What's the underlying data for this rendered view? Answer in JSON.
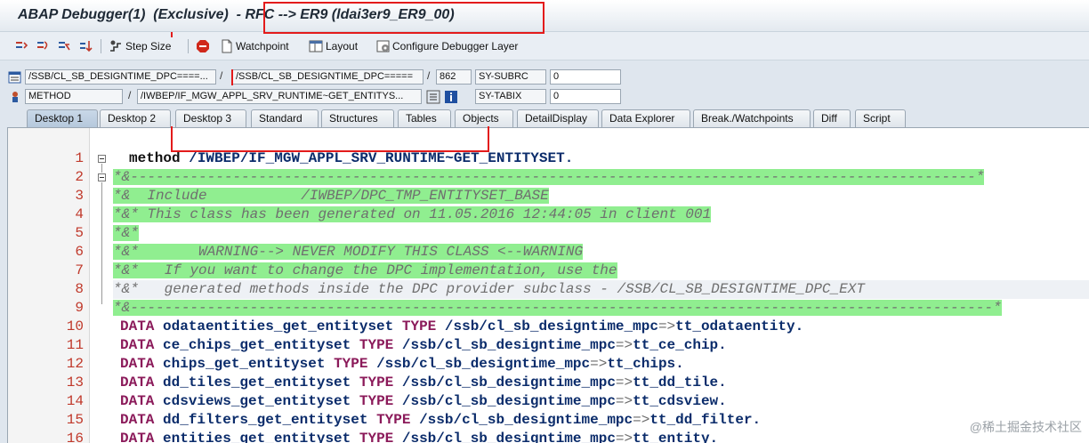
{
  "window": {
    "title": "ABAP Debugger(1)  (Exclusive)  - RFC --> ER9 (ldai3er9_ER9_00)"
  },
  "toolbar": {
    "step_size": "Step Size",
    "watchpoint": "Watchpoint",
    "layout": "Layout",
    "configure": "Configure Debugger Layer"
  },
  "info": {
    "program1": "/SSB/CL_SB_DESIGNTIME_DPC====...",
    "program2": "/SSB/CL_SB_DESIGNTIME_DPC=====",
    "line_no": "862",
    "sysvar1_name": "SY-SUBRC",
    "sysvar1_value": "0",
    "type": "METHOD",
    "method": "/IWBEP/IF_MGW_APPL_SRV_RUNTIME~GET_ENTITYS...",
    "sysvar2_name": "SY-TABIX",
    "sysvar2_value": "0"
  },
  "tabs": [
    {
      "label": "Desktop 1"
    },
    {
      "label": "Desktop 2"
    },
    {
      "label": "Desktop 3"
    },
    {
      "label": "Standard"
    },
    {
      "label": "Structures"
    },
    {
      "label": "Tables"
    },
    {
      "label": "Objects"
    },
    {
      "label": "DetailDisplay"
    },
    {
      "label": "Data Explorer"
    },
    {
      "label": "Break./Watchpoints"
    },
    {
      "label": "Diff"
    },
    {
      "label": "Script"
    }
  ],
  "code": {
    "line_numbers": [
      "1",
      "2",
      "3",
      "4",
      "5",
      "6",
      "7",
      "8",
      "9",
      "10",
      "11",
      "12",
      "13",
      "14",
      "15",
      "16"
    ],
    "l1_kw": "method",
    "l1_name": "/IWBEP/IF_MGW_APPL_SRV_RUNTIME~GET_ENTITYSET.",
    "l2": "*&---------------------------------------------------------------------------------------------------*",
    "l3": "*&  Include           /IWBEP/DPC_TMP_ENTITYSET_BASE",
    "l4": "*&* This class has been generated on 11.05.2016 12:44:05 in client 001",
    "l5": "*&*",
    "l6": "*&*       WARNING--> NEVER MODIFY THIS CLASS <--WARNING",
    "l7": "*&*   If you want to change the DPC implementation, use the",
    "l8": "*&*   generated methods inside the DPC provider subclass - /SSB/CL_SB_DESIGNTIME_DPC_EXT",
    "l9": "*&-----------------------------------------------------------------------------------------------------*",
    "data_kw": "DATA",
    "type_kw": "TYPE",
    "arrow": "=>",
    "d10_var": "odataentities_get_entityset",
    "d10_cls": "/ssb/cl_sb_designtime_mpc",
    "d10_typ": "tt_odataentity.",
    "d11_var": "ce_chips_get_entityset",
    "d11_cls": "/ssb/cl_sb_designtime_mpc",
    "d11_typ": "tt_ce_chip.",
    "d12_var": "chips_get_entityset",
    "d12_cls": "/ssb/cl_sb_designtime_mpc",
    "d12_typ": "tt_chips.",
    "d13_var": "dd_tiles_get_entityset",
    "d13_cls": "/ssb/cl_sb_designtime_mpc",
    "d13_typ": "tt_dd_tile.",
    "d14_var": "cdsviews_get_entityset",
    "d14_cls": "/ssb/cl_sb_designtime_mpc",
    "d14_typ": "tt_cdsview.",
    "d15_var": "dd_filters_get_entityset",
    "d15_cls": "/ssb/cl_sb_designtime_mpc",
    "d15_typ": "tt_dd_filter.",
    "d16_var": "entities_get_entityset",
    "d16_cls": "/ssb/cl_sb_designtime_mpc",
    "d16_typ": "tt_entity."
  },
  "watermark": "@稀土掘金技术社区",
  "colors": {
    "annotation_red": "#e31b1b",
    "comment_bg": "#90ee90",
    "keyword": "#8b1a5a",
    "line_number": "#c0392b"
  }
}
